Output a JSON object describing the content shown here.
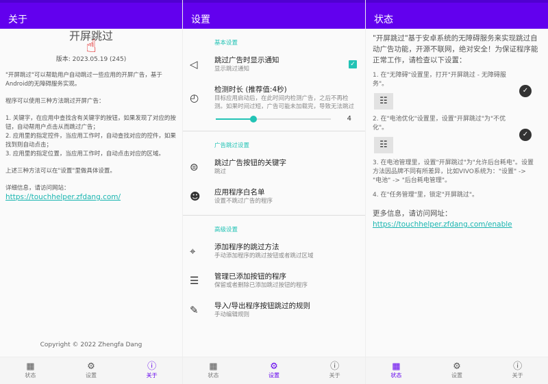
{
  "about": {
    "title": "关于",
    "app_name": "开屏跳过",
    "version": "版本: 2023.05.19 (245)",
    "intro": "\"开屏跳过\"可以帮助用户自动跳过一些应用的开屏广告，基于Android的无障碍服务实现。",
    "methods_title": "程序可以使用三种方法跳过开屏广告：",
    "methods": [
      "1. 关键字，在应用中查找含有关键字的按钮，如果发现了对应的按钮，自动帮用户点击从而跳过广告；",
      "2. 应用里的指定控件，当应用工作时，自动查找对应的控件，如果找到则自动点击；",
      "3. 应用里的指定位置，当应用工作时，自动点击对应的区域。"
    ],
    "settings_note": "上述三种方法可以在\"设置\"里做具体设置。",
    "detail": "详细信息，请访问网站：",
    "link": "https://touchhelper.zfdang.com/",
    "copyright": "Copyright © 2022 Zhengfa Dang"
  },
  "settings": {
    "title": "设置",
    "sec_basic": "基本设置",
    "sec_skip": "广告跳过设置",
    "sec_adv": "高级设置",
    "notify": {
      "title": "跳过广告时显示通知",
      "sub": "显示跳过通知",
      "checked": true
    },
    "duration": {
      "title": "检测时长 (推荐值:4秒)",
      "sub": "目标应用启动后，在此时间内检测广告，之后不再检测。如果时间过短，广告可能未加载完，导致无法跳过",
      "value": "4",
      "min": 0,
      "max": 10
    },
    "keyword": {
      "title": "跳过广告按钮的关键字",
      "sub": "跳过"
    },
    "whitelist": {
      "title": "应用程序白名单",
      "sub": "设置不跳过广告的程序"
    },
    "addmethod": {
      "title": "添加程序的跳过方法",
      "sub": "手动添加程序的跳过按钮或者跳过区域"
    },
    "manage": {
      "title": "管理已添加按钮的程序",
      "sub": "保留或者删除已添加跳过按钮的程序"
    },
    "import": {
      "title": "导入/导出程序按钮跳过的规则",
      "sub": "手动编辑规则"
    }
  },
  "status": {
    "title": "状态",
    "intro": "\"开屏跳过\"基于安卓系统的无障碍服务来实现跳过自动广告功能，开源不联网，绝对安全！为保证程序能正常工作，请检查以下设置：",
    "step1": "1. 在\"无障碍\"设置里，打开\"开屏跳过 - 无障碍服务\"。",
    "step2": "2. 在\"电池优化\"设置里，设置\"开屏跳过\"为\"不优化\"。",
    "step3": "3. 在电池管理里，设置\"开屏跳过\"为\"允许后台耗电\"。设置方法因品牌不同有所差异，比如VIVO系统为：\"设置\" -> \"电池\" -> \"后台耗电管理\"。",
    "step4": "4. 在\"任务管理\"里，锁定\"开屏跳过\"。",
    "more": "更多信息，请访问网址：",
    "link": "https://touchhelper.zfdang.com/enable"
  },
  "nav": {
    "status": "状态",
    "settings": "设置",
    "about": "关于"
  },
  "colors": {
    "primary": "#6200ee",
    "accent": "#22c3b5"
  }
}
